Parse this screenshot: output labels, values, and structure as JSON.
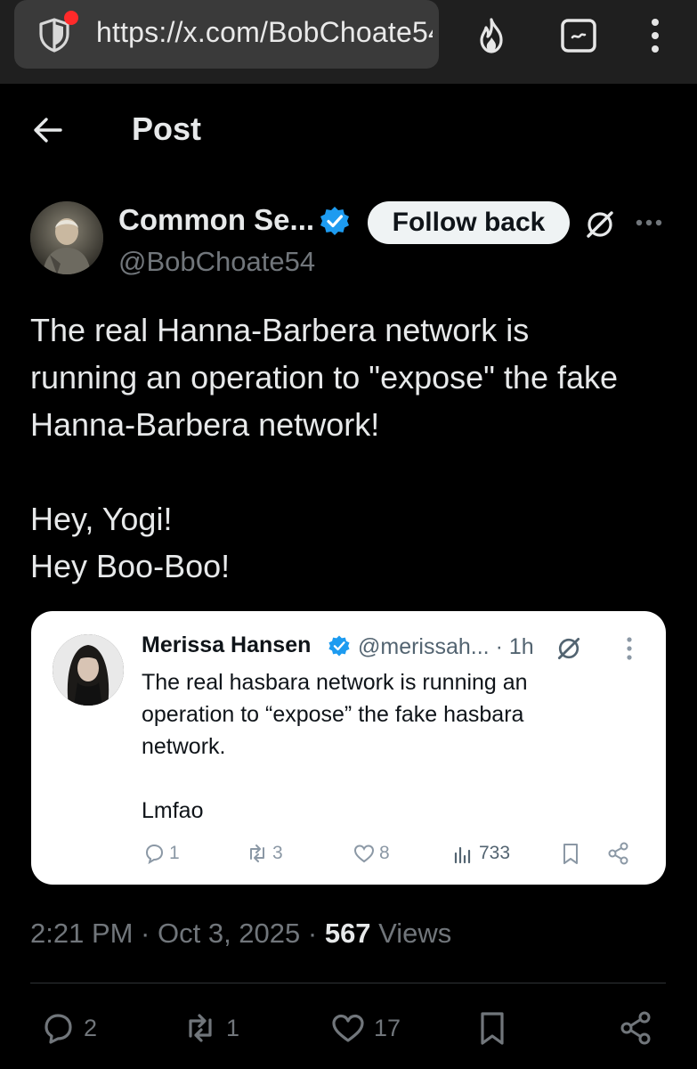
{
  "browser": {
    "url": "https://x.com/BobChoate54",
    "icons": [
      "shield-icon",
      "fire-icon",
      "tab-switcher-icon",
      "menu-icon"
    ],
    "alert_color": "#ff2a2a"
  },
  "header": {
    "title": "Post"
  },
  "author": {
    "name": "Common Se...",
    "handle": "@BobChoate54",
    "verified": true,
    "follow_label": "Follow back"
  },
  "post": {
    "text": "The real Hanna-Barbera network is\nrunning an operation to \"expose\" the fake\nHanna-Barbera network!\n\nHey, Yogi!\nHey Boo-Boo!"
  },
  "quote": {
    "name": "Merissa Hansen",
    "handle": "@merissah...",
    "time": "· 1h",
    "verified": true,
    "text": "The real hasbara network is running an\noperation to “expose” the fake hasbara\nnetwork.\n\nLmfao",
    "replies": "1",
    "reposts": "3",
    "likes": "8",
    "views": "733"
  },
  "meta": {
    "time": "2:21 PM · Oct 3, 2025 · ",
    "views_count": "567",
    "views_label": " Views"
  },
  "actions": {
    "replies": "2",
    "reposts": "1",
    "likes": "17"
  },
  "colors": {
    "background": "#000000",
    "verified_blue": "#1d9bf0",
    "muted_text": "#71767b"
  }
}
